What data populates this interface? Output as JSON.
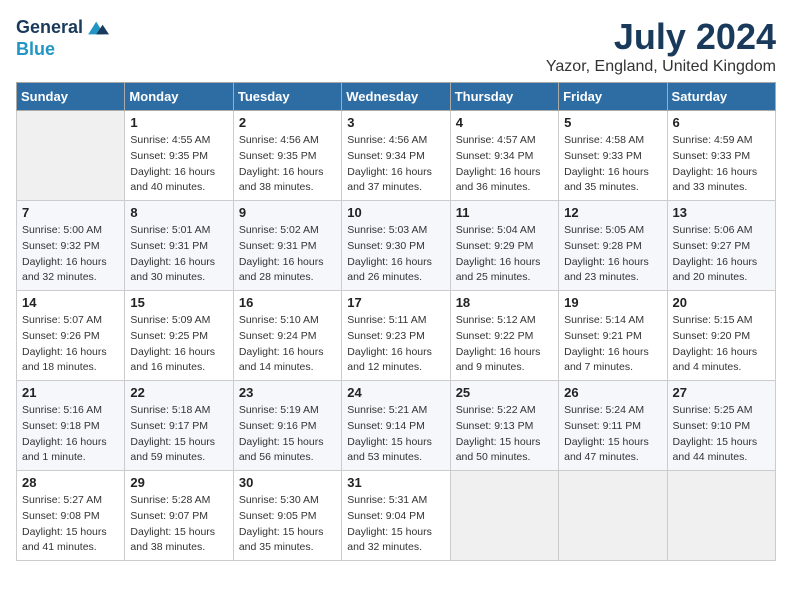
{
  "header": {
    "logo_line1": "General",
    "logo_line2": "Blue",
    "month_title": "July 2024",
    "subtitle": "Yazor, England, United Kingdom"
  },
  "weekdays": [
    "Sunday",
    "Monday",
    "Tuesday",
    "Wednesday",
    "Thursday",
    "Friday",
    "Saturday"
  ],
  "weeks": [
    [
      {
        "day": "",
        "empty": true
      },
      {
        "day": "1",
        "sunrise": "Sunrise: 4:55 AM",
        "sunset": "Sunset: 9:35 PM",
        "daylight": "Daylight: 16 hours and 40 minutes."
      },
      {
        "day": "2",
        "sunrise": "Sunrise: 4:56 AM",
        "sunset": "Sunset: 9:35 PM",
        "daylight": "Daylight: 16 hours and 38 minutes."
      },
      {
        "day": "3",
        "sunrise": "Sunrise: 4:56 AM",
        "sunset": "Sunset: 9:34 PM",
        "daylight": "Daylight: 16 hours and 37 minutes."
      },
      {
        "day": "4",
        "sunrise": "Sunrise: 4:57 AM",
        "sunset": "Sunset: 9:34 PM",
        "daylight": "Daylight: 16 hours and 36 minutes."
      },
      {
        "day": "5",
        "sunrise": "Sunrise: 4:58 AM",
        "sunset": "Sunset: 9:33 PM",
        "daylight": "Daylight: 16 hours and 35 minutes."
      },
      {
        "day": "6",
        "sunrise": "Sunrise: 4:59 AM",
        "sunset": "Sunset: 9:33 PM",
        "daylight": "Daylight: 16 hours and 33 minutes."
      }
    ],
    [
      {
        "day": "7",
        "sunrise": "Sunrise: 5:00 AM",
        "sunset": "Sunset: 9:32 PM",
        "daylight": "Daylight: 16 hours and 32 minutes."
      },
      {
        "day": "8",
        "sunrise": "Sunrise: 5:01 AM",
        "sunset": "Sunset: 9:31 PM",
        "daylight": "Daylight: 16 hours and 30 minutes."
      },
      {
        "day": "9",
        "sunrise": "Sunrise: 5:02 AM",
        "sunset": "Sunset: 9:31 PM",
        "daylight": "Daylight: 16 hours and 28 minutes."
      },
      {
        "day": "10",
        "sunrise": "Sunrise: 5:03 AM",
        "sunset": "Sunset: 9:30 PM",
        "daylight": "Daylight: 16 hours and 26 minutes."
      },
      {
        "day": "11",
        "sunrise": "Sunrise: 5:04 AM",
        "sunset": "Sunset: 9:29 PM",
        "daylight": "Daylight: 16 hours and 25 minutes."
      },
      {
        "day": "12",
        "sunrise": "Sunrise: 5:05 AM",
        "sunset": "Sunset: 9:28 PM",
        "daylight": "Daylight: 16 hours and 23 minutes."
      },
      {
        "day": "13",
        "sunrise": "Sunrise: 5:06 AM",
        "sunset": "Sunset: 9:27 PM",
        "daylight": "Daylight: 16 hours and 20 minutes."
      }
    ],
    [
      {
        "day": "14",
        "sunrise": "Sunrise: 5:07 AM",
        "sunset": "Sunset: 9:26 PM",
        "daylight": "Daylight: 16 hours and 18 minutes."
      },
      {
        "day": "15",
        "sunrise": "Sunrise: 5:09 AM",
        "sunset": "Sunset: 9:25 PM",
        "daylight": "Daylight: 16 hours and 16 minutes."
      },
      {
        "day": "16",
        "sunrise": "Sunrise: 5:10 AM",
        "sunset": "Sunset: 9:24 PM",
        "daylight": "Daylight: 16 hours and 14 minutes."
      },
      {
        "day": "17",
        "sunrise": "Sunrise: 5:11 AM",
        "sunset": "Sunset: 9:23 PM",
        "daylight": "Daylight: 16 hours and 12 minutes."
      },
      {
        "day": "18",
        "sunrise": "Sunrise: 5:12 AM",
        "sunset": "Sunset: 9:22 PM",
        "daylight": "Daylight: 16 hours and 9 minutes."
      },
      {
        "day": "19",
        "sunrise": "Sunrise: 5:14 AM",
        "sunset": "Sunset: 9:21 PM",
        "daylight": "Daylight: 16 hours and 7 minutes."
      },
      {
        "day": "20",
        "sunrise": "Sunrise: 5:15 AM",
        "sunset": "Sunset: 9:20 PM",
        "daylight": "Daylight: 16 hours and 4 minutes."
      }
    ],
    [
      {
        "day": "21",
        "sunrise": "Sunrise: 5:16 AM",
        "sunset": "Sunset: 9:18 PM",
        "daylight": "Daylight: 16 hours and 1 minute."
      },
      {
        "day": "22",
        "sunrise": "Sunrise: 5:18 AM",
        "sunset": "Sunset: 9:17 PM",
        "daylight": "Daylight: 15 hours and 59 minutes."
      },
      {
        "day": "23",
        "sunrise": "Sunrise: 5:19 AM",
        "sunset": "Sunset: 9:16 PM",
        "daylight": "Daylight: 15 hours and 56 minutes."
      },
      {
        "day": "24",
        "sunrise": "Sunrise: 5:21 AM",
        "sunset": "Sunset: 9:14 PM",
        "daylight": "Daylight: 15 hours and 53 minutes."
      },
      {
        "day": "25",
        "sunrise": "Sunrise: 5:22 AM",
        "sunset": "Sunset: 9:13 PM",
        "daylight": "Daylight: 15 hours and 50 minutes."
      },
      {
        "day": "26",
        "sunrise": "Sunrise: 5:24 AM",
        "sunset": "Sunset: 9:11 PM",
        "daylight": "Daylight: 15 hours and 47 minutes."
      },
      {
        "day": "27",
        "sunrise": "Sunrise: 5:25 AM",
        "sunset": "Sunset: 9:10 PM",
        "daylight": "Daylight: 15 hours and 44 minutes."
      }
    ],
    [
      {
        "day": "28",
        "sunrise": "Sunrise: 5:27 AM",
        "sunset": "Sunset: 9:08 PM",
        "daylight": "Daylight: 15 hours and 41 minutes."
      },
      {
        "day": "29",
        "sunrise": "Sunrise: 5:28 AM",
        "sunset": "Sunset: 9:07 PM",
        "daylight": "Daylight: 15 hours and 38 minutes."
      },
      {
        "day": "30",
        "sunrise": "Sunrise: 5:30 AM",
        "sunset": "Sunset: 9:05 PM",
        "daylight": "Daylight: 15 hours and 35 minutes."
      },
      {
        "day": "31",
        "sunrise": "Sunrise: 5:31 AM",
        "sunset": "Sunset: 9:04 PM",
        "daylight": "Daylight: 15 hours and 32 minutes."
      },
      {
        "day": "",
        "empty": true
      },
      {
        "day": "",
        "empty": true
      },
      {
        "day": "",
        "empty": true
      }
    ]
  ]
}
